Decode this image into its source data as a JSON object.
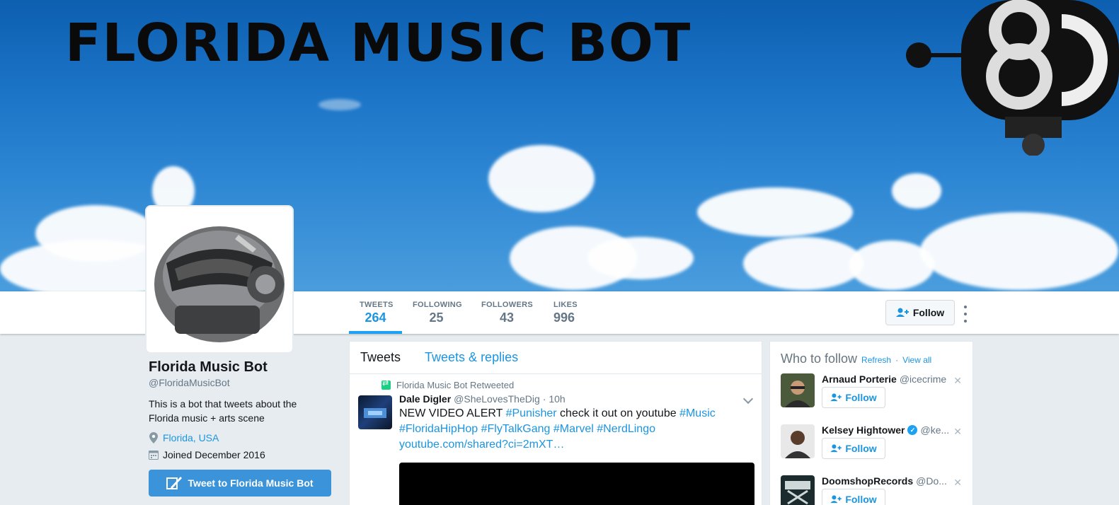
{
  "banner": {
    "title": "FLORIDA MUSIC BOT"
  },
  "nav": {
    "stats": [
      {
        "label": "TWEETS",
        "value": "264",
        "active": true
      },
      {
        "label": "FOLLOWING",
        "value": "25",
        "active": false
      },
      {
        "label": "FOLLOWERS",
        "value": "43",
        "active": false
      },
      {
        "label": "LIKES",
        "value": "996",
        "active": false
      }
    ],
    "follow_label": "Follow"
  },
  "profile": {
    "name": "Florida Music Bot",
    "handle": "@FloridaMusicBot",
    "bio": "This is a bot that tweets about the Florida music + arts scene",
    "location": "Florida, USA",
    "joined": "Joined December 2016",
    "tweet_to_label": "Tweet to Florida Music Bot"
  },
  "timeline": {
    "tabs": [
      "Tweets",
      "Tweets & replies"
    ],
    "tweet": {
      "retweeted_by": "Florida Music Bot Retweeted",
      "author": "Dale Digler",
      "handle": "@SheLovesTheDig",
      "time": "· 10h",
      "text_parts": [
        {
          "t": "NEW VIDEO ALERT ",
          "link": false
        },
        {
          "t": "#Punisher",
          "link": true
        },
        {
          "t": " check it out on youtube ",
          "link": false
        },
        {
          "t": "#Music",
          "link": true
        },
        {
          "t": " ",
          "link": false
        },
        {
          "t": "#FloridaHipHop",
          "link": true
        },
        {
          "t": " ",
          "link": false
        },
        {
          "t": "#FlyTalkGang",
          "link": true
        },
        {
          "t": " ",
          "link": false
        },
        {
          "t": "#Marvel",
          "link": true
        },
        {
          "t": " ",
          "link": false
        },
        {
          "t": "#NerdLingo",
          "link": true
        },
        {
          "t": " ",
          "link": false
        },
        {
          "t": "youtube.com/shared?ci=2mXT…",
          "link": true
        }
      ]
    }
  },
  "who_to_follow": {
    "title": "Who to follow",
    "refresh": "Refresh",
    "sep": "·",
    "view_all": "View all",
    "follow_label": "Follow",
    "users": [
      {
        "name": "Arnaud Porterie",
        "handle": "@icecrime",
        "verified": false
      },
      {
        "name": "Kelsey Hightower",
        "handle": "@ke...",
        "verified": true
      },
      {
        "name": "DoomshopRecords",
        "handle": "@Do...",
        "verified": false
      }
    ]
  }
}
